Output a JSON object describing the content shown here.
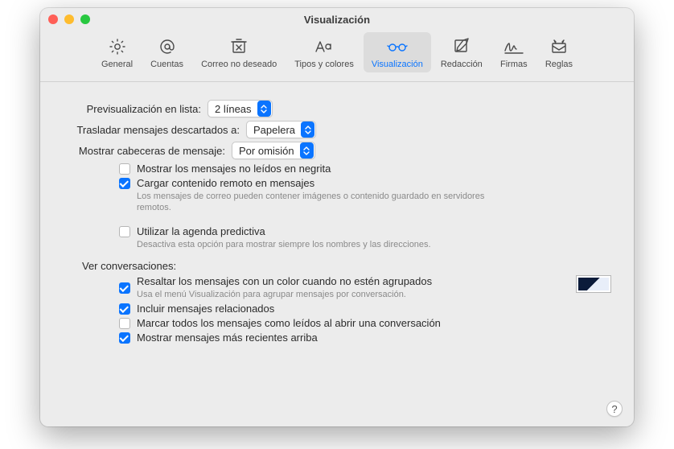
{
  "window_title": "Visualización",
  "tabs": [
    {
      "label": "General"
    },
    {
      "label": "Cuentas"
    },
    {
      "label": "Correo no deseado"
    },
    {
      "label": "Tipos y colores"
    },
    {
      "label": "Visualización"
    },
    {
      "label": "Redacción"
    },
    {
      "label": "Firmas"
    },
    {
      "label": "Reglas"
    }
  ],
  "preview": {
    "label": "Previsualización en lista:",
    "value": "2 líneas"
  },
  "discarded": {
    "label": "Trasladar mensajes descartados a:",
    "value": "Papelera"
  },
  "headers": {
    "label": "Mostrar cabeceras de mensaje:",
    "value": "Por omisión"
  },
  "checkboxes": {
    "unread_bold": {
      "label": "Mostrar los mensajes no leídos en negrita",
      "checked": false
    },
    "remote_content": {
      "label": "Cargar contenido remoto en mensajes",
      "desc": "Los mensajes de correo pueden contener imágenes o contenido guardado en servidores remotos.",
      "checked": true
    },
    "predictive": {
      "label": "Utilizar la agenda predictiva",
      "desc": "Desactiva esta opción para mostrar siempre los nombres y las direcciones.",
      "checked": false
    }
  },
  "conversations": {
    "section_label": "Ver conversaciones:",
    "highlight": {
      "label": "Resaltar los mensajes con un color cuando no estén agrupados",
      "desc": "Usa el menú Visualización para agrupar mensajes por conversación.",
      "checked": true
    },
    "include_related": {
      "label": "Incluir mensajes relacionados",
      "checked": true
    },
    "mark_all_read": {
      "label": "Marcar todos los mensajes como leídos al abrir una conversación",
      "checked": false
    },
    "recent_top": {
      "label": "Mostrar mensajes más recientes arriba",
      "checked": true
    }
  },
  "help": "?"
}
